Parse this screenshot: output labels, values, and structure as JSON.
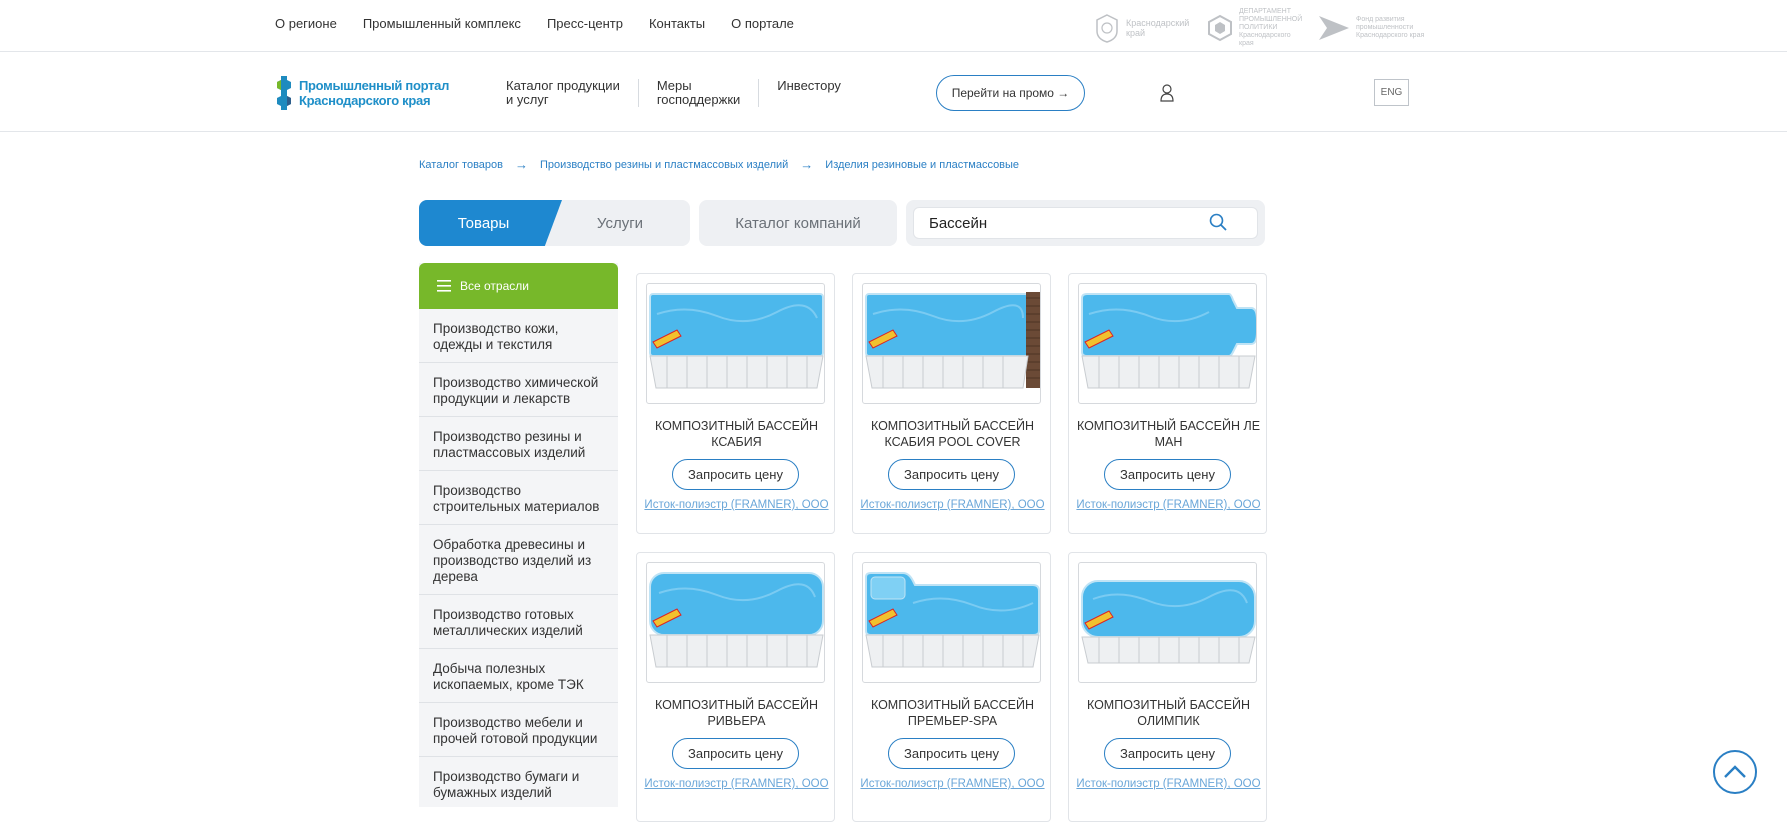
{
  "topnav": {
    "items": [
      "О регионе",
      "Промышленный комплекс",
      "Пресс-центр",
      "Контакты",
      "О портале"
    ]
  },
  "partners": [
    {
      "label": "Краснодарский край"
    },
    {
      "label": "ДЕПАРТАМЕНТ ПРОМЫШЛЕННОЙ ПОЛИТИКИ Краснодарского края"
    },
    {
      "label": "Фонд развития промышленности Краснодарского края"
    }
  ],
  "header": {
    "logo_line1": "Промышленный портал",
    "logo_line2": "Краснодарского края",
    "nav": [
      {
        "line1": "Каталог продукции",
        "line2": "и услуг"
      },
      {
        "line1": "Меры",
        "line2": "господдержки"
      },
      {
        "line1": "Инвестору",
        "line2": ""
      }
    ],
    "promo_label": "Перейти на промо →",
    "lang_label": "ENG"
  },
  "breadcrumb": {
    "items": [
      "Каталог товаров",
      "Производство резины и пластмассовых изделий",
      "Изделия резиновые и пластмассовые"
    ],
    "separator": "→"
  },
  "tabs": {
    "goods": "Товары",
    "services": "Услуги",
    "catalog": "Каталог компаний"
  },
  "search": {
    "value": "Бассейн"
  },
  "sidebar": {
    "all_label": "Все отрасли",
    "items": [
      "Производство кожи, одежды и текстиля",
      "Производство химической продукции и лекарств",
      "Производство резины и пластмассовых изделий",
      "Производство строительных материалов",
      "Обработка древесины и производство изделий из дерева",
      "Производство готовых металлических изделий",
      "Добыча полезных ископаемых, кроме ТЭК",
      "Производство мебели и прочей готовой продукции",
      "Производство бумаги и бумажных изделий"
    ]
  },
  "products": [
    {
      "title": "КОМПОЗИТНЫЙ БАССЕЙН КСАБИЯ",
      "button": "Запросить цену",
      "company": "Исток-полиэстр (FRAMNER), ООО"
    },
    {
      "title": "КОМПОЗИТНЫЙ БАССЕЙН КСАБИЯ POOL COVER",
      "button": "Запросить цену",
      "company": "Исток-полиэстр (FRAMNER), ООО"
    },
    {
      "title": "КОМПОЗИТНЫЙ БАССЕЙН ЛЕ МАН",
      "button": "Запросить цену",
      "company": "Исток-полиэстр (FRAMNER), ООО"
    },
    {
      "title": "КОМПОЗИТНЫЙ БАССЕЙН РИВЬЕРА",
      "button": "Запросить цену",
      "company": "Исток-полиэстр (FRAMNER), ООО"
    },
    {
      "title": "КОМПОЗИТНЫЙ БАССЕЙН ПРЕМЬЕР-SPA",
      "button": "Запросить цену",
      "company": "Исток-полиэстр (FRAMNER), ООО"
    },
    {
      "title": "КОМПОЗИТНЫЙ БАССЕЙН ОЛИМПИК",
      "button": "Запросить цену",
      "company": "Исток-полиэстр (FRAMNER), ООО"
    }
  ],
  "colors": {
    "accent_blue": "#1e88d0",
    "accent_green": "#77b82a",
    "pool_water": "#4cb8ec"
  }
}
